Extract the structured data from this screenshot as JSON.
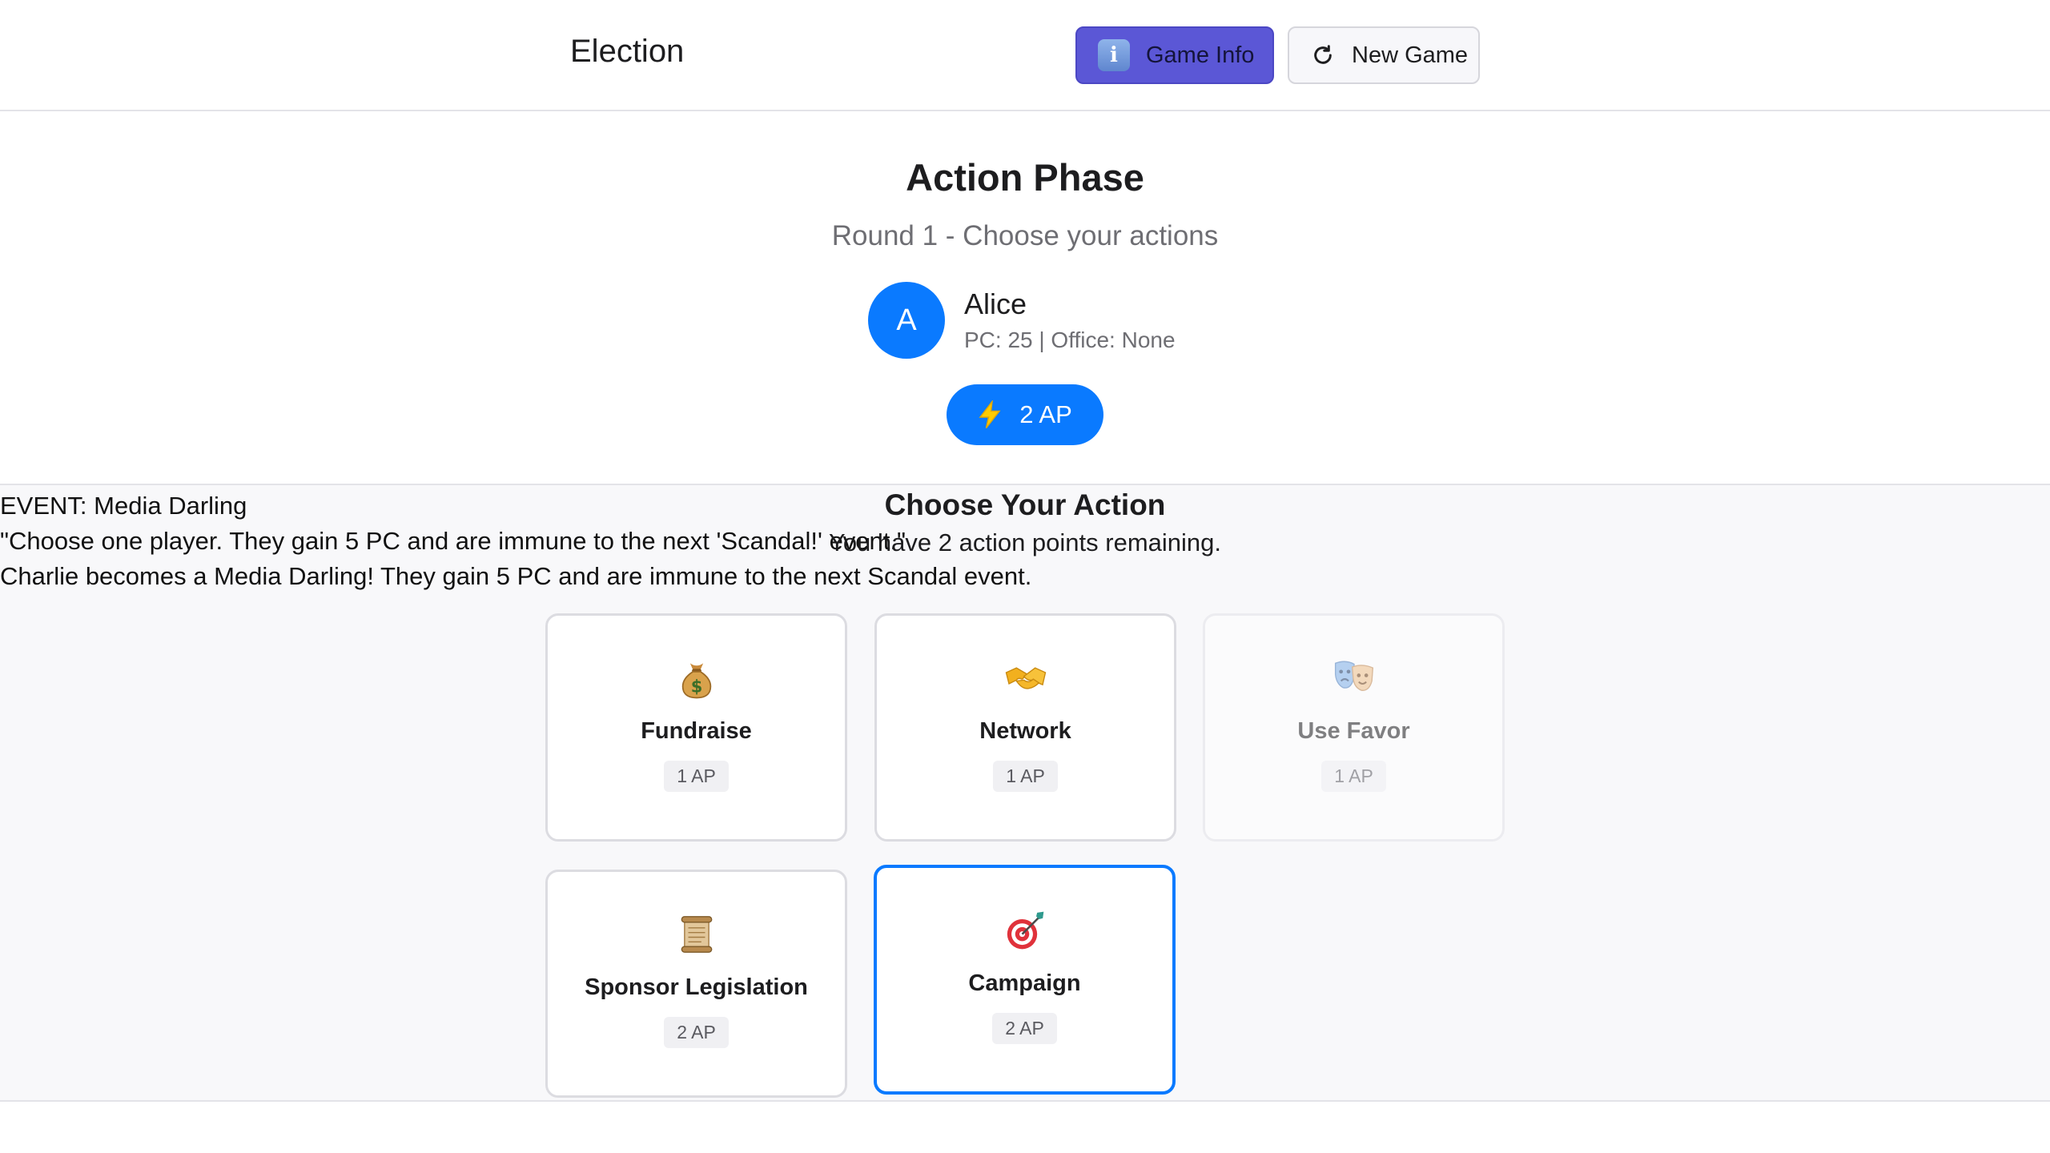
{
  "header": {
    "title": "Election",
    "game_info_label": "Game Info",
    "new_game_label": "New Game"
  },
  "phase": {
    "title": "Action Phase",
    "subtitle": "Round 1 - Choose your actions"
  },
  "player": {
    "initial": "A",
    "name": "Alice",
    "stats": "PC: 25 | Office: None",
    "action_points": "2 AP"
  },
  "event": {
    "line1": "EVENT: Media Darling",
    "line2": "\"Choose one player. They gain 5 PC and are immune to the next 'Scandal!' event.\"",
    "line3": "Charlie becomes a Media Darling! They gain 5 PC and are immune to the next Scandal event."
  },
  "actions_section": {
    "title": "Choose Your Action",
    "subtitle": "You have 2 action points remaining."
  },
  "actions": [
    {
      "label": "Fundraise",
      "cost": "1 AP",
      "icon": "money-bag-icon",
      "state": "enabled"
    },
    {
      "label": "Network",
      "cost": "1 AP",
      "icon": "handshake-icon",
      "state": "enabled"
    },
    {
      "label": "Use Favor",
      "cost": "1 AP",
      "icon": "theater-masks-icon",
      "state": "disabled"
    },
    {
      "label": "Sponsor Legislation",
      "cost": "2 AP",
      "icon": "scroll-icon",
      "state": "enabled"
    },
    {
      "label": "Campaign",
      "cost": "2 AP",
      "icon": "target-icon",
      "state": "selected"
    }
  ],
  "colors": {
    "accent": "#0a7aff",
    "info_button": "#5b57d6",
    "area_background": "#f8f8fa"
  }
}
